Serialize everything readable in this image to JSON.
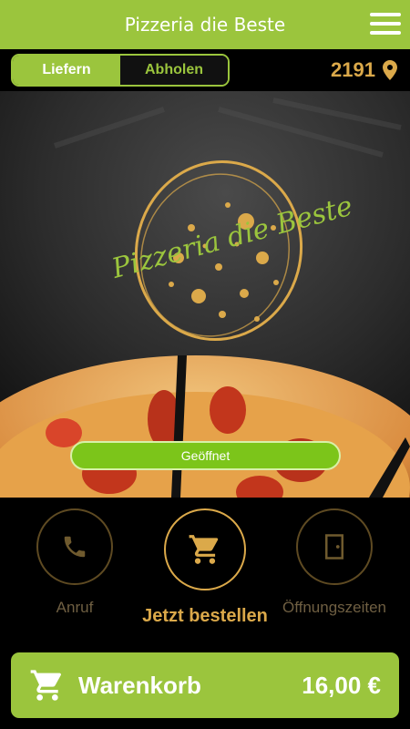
{
  "header": {
    "title": "Pizzeria die Beste",
    "menu_icon": "hamburger-menu-icon"
  },
  "mode_toggle": {
    "options": [
      "Liefern",
      "Abholen"
    ],
    "selected": "Liefern"
  },
  "location": {
    "postcode": "2191",
    "icon": "location-pin-icon"
  },
  "hero": {
    "logo_text": "Pizzeria die Beste",
    "status_label": "Geöffnet"
  },
  "actions": [
    {
      "label": "Anruf",
      "icon": "phone-icon"
    },
    {
      "label": "Jetzt bestellen",
      "icon": "shopping-cart-icon"
    },
    {
      "label": "Öffnungszeiten",
      "icon": "door-icon"
    }
  ],
  "cart": {
    "label": "Warenkorb",
    "total": "16,00 €",
    "icon": "shopping-cart-icon"
  },
  "colors": {
    "brand_green": "#9bc53d",
    "gold": "#dba94a",
    "status_green": "#7cc51a",
    "background": "#000000"
  }
}
